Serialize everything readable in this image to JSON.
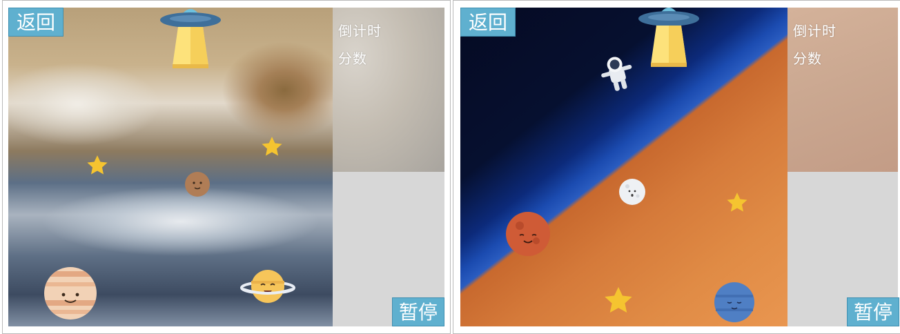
{
  "screens": [
    {
      "back_button": "返回",
      "hud": {
        "countdown_label": "倒计时",
        "score_label": "分数"
      },
      "pause_button": "暂停",
      "background": "jupiter-surface",
      "sprites": [
        "ufo-icon",
        "star-icon",
        "star-icon",
        "mars-planet-icon",
        "jupiter-planet-icon",
        "saturn-planet-icon"
      ]
    },
    {
      "back_button": "返回",
      "hud": {
        "countdown_label": "倒计时",
        "score_label": "分数"
      },
      "pause_button": "暂停",
      "background": "space-orange-planet",
      "sprites": [
        "ufo-icon",
        "astronaut-icon",
        "moon-planet-icon",
        "mars-planet-icon",
        "star-icon",
        "star-icon",
        "neptune-planet-icon"
      ]
    }
  ],
  "colors": {
    "button_bg": "#5fb0cf",
    "sidebar_gray": "#d7d7d7",
    "star": "#f5c430",
    "ufo_dome": "#6ec1de",
    "ufo_body": "#3e6f9a",
    "ufo_beam": "#fde27b"
  }
}
